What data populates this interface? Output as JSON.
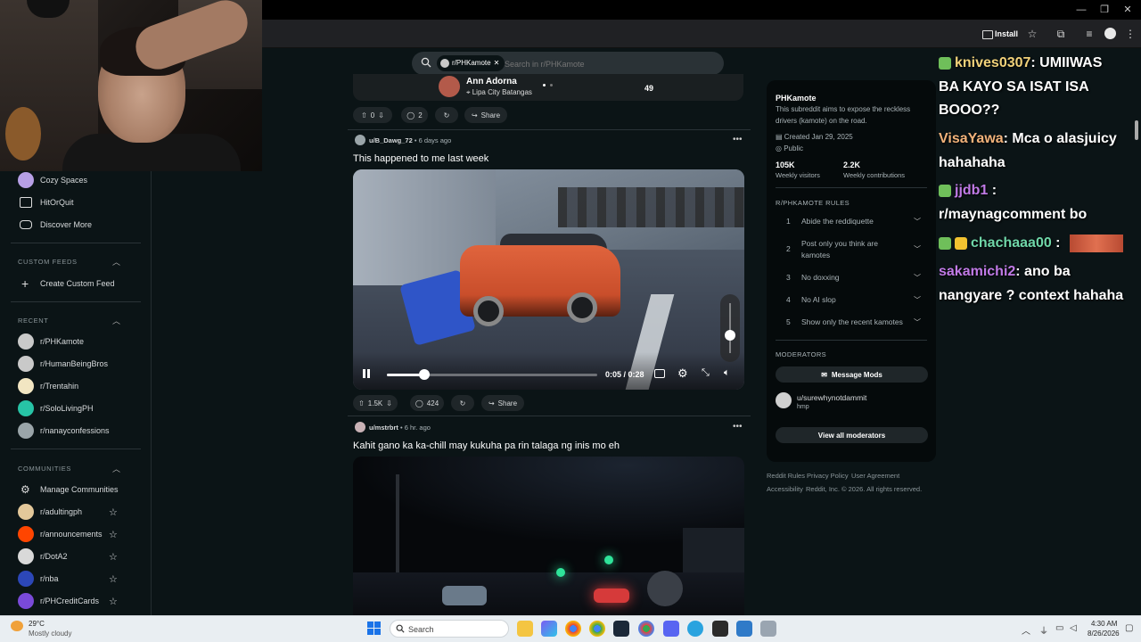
{
  "browser": {
    "install_label": "Install"
  },
  "search": {
    "chip_label": "r/PHKamote",
    "placeholder": "Search in r/PHKamote"
  },
  "sidebar": {
    "top_items": [
      {
        "label": "Cozy Spaces",
        "color": "#b7a0e6"
      },
      {
        "label": "HitOrQuit",
        "color": "#ffffff"
      },
      {
        "label": "Discover More",
        "color": "#ffffff"
      }
    ],
    "custom_feeds_heading": "CUSTOM FEEDS",
    "create_custom_feed": "Create Custom Feed",
    "recent_heading": "RECENT",
    "recent_items": [
      {
        "label": "r/PHKamote",
        "color": "#c9c9c9"
      },
      {
        "label": "r/HumanBeingBros",
        "color": "#c9c9c9"
      },
      {
        "label": "r/Trentahin",
        "color": "#f2e6c2"
      },
      {
        "label": "r/SoloLivingPH",
        "color": "#27c4a6"
      },
      {
        "label": "r/nanayconfessions",
        "color": "#9aa5a9"
      }
    ],
    "communities_heading": "COMMUNITIES",
    "manage_communities": "Manage Communities",
    "communities": [
      {
        "label": "r/adultingph",
        "color": "#e3c89a"
      },
      {
        "label": "r/announcements",
        "color": "#ff4500"
      },
      {
        "label": "r/DotA2",
        "color": "#d9d9d9"
      },
      {
        "label": "r/nba",
        "color": "#2c47b8"
      },
      {
        "label": "r/PHCreditCards",
        "color": "#7a4ad9"
      }
    ]
  },
  "feed": {
    "post0": {
      "author_name": "Ann Adorna",
      "location": "Lipa City Batangas",
      "side_number": "49",
      "votes": "0",
      "comments": "2",
      "share": "Share"
    },
    "post1": {
      "author": "u/B_Dawg_72",
      "age": "• 6 days ago",
      "title": "This happened to me last week",
      "votes": "1.5K",
      "comments": "424",
      "share": "Share",
      "time_current": "0:05",
      "time_total": "0:28",
      "time_display": "0:05 / 0:28",
      "progress": 0.18,
      "volume": 0.35
    },
    "post2": {
      "author": "u/mstrbrt",
      "age": "• 6 hr. ago",
      "title": "Kahit gano ka ka-chill may kukuha pa rin talaga ng inis mo eh"
    }
  },
  "community": {
    "name": "PHKamote",
    "description_line1": "This subreddit aims to expose the reckless",
    "description_line2": "drivers (kamote) on the road.",
    "created": "Created Jan 29, 2025",
    "visibility": "Public",
    "visitors_value": "105K",
    "visitors_label": "Weekly visitors",
    "contrib_value": "2.2K",
    "contrib_label": "Weekly contributions",
    "rules_heading": "R/PHKAMOTE RULES",
    "rules": [
      {
        "num": "1",
        "line1": "Abide the reddiquette",
        "line2": ""
      },
      {
        "num": "2",
        "line1": "Post only you think are",
        "line2": "kamotes"
      },
      {
        "num": "3",
        "line1": "No doxxing",
        "line2": ""
      },
      {
        "num": "4",
        "line1": "No AI slop",
        "line2": ""
      },
      {
        "num": "5",
        "line1": "Show only the recent kamotes",
        "line2": ""
      }
    ],
    "moderators_heading": "MODERATORS",
    "message_mods": "Message Mods",
    "mod_name": "u/surewhynotdammit",
    "mod_flair": "hmp",
    "view_all_mods": "View all moderators"
  },
  "footer": {
    "links": [
      "Reddit Rules",
      "Privacy Policy",
      "User Agreement"
    ],
    "accessibility": "Accessibility",
    "copyright": "Reddit, Inc. © 2026. All rights reserved."
  },
  "chat": [
    {
      "user": "knives0307",
      "user_color": "#f2d27a",
      "message": ": UMIIWAS"
    },
    {
      "user": "",
      "user_color": "#ffffff",
      "message": "BA KAYO SA ISAT ISA"
    },
    {
      "user": "",
      "user_color": "#ffffff",
      "message": "BOOO??"
    },
    {
      "user": "VisaYawa",
      "user_color": "#f2b27a",
      "message": ": Mca o alasjuicy"
    },
    {
      "user": "",
      "user_color": "#ffffff",
      "message": "hahahaha"
    },
    {
      "user": "jjdb1",
      "user_color": "#c07ae6",
      "message": " :"
    },
    {
      "user": "",
      "user_color": "#ffffff",
      "message": "r/maynagcomment bo"
    },
    {
      "user": "chachaaa00",
      "user_color": "#6fd6a8",
      "message": " :"
    },
    {
      "user": "sakamichi2",
      "user_color": "#c07ae6",
      "message": ": ano ba"
    },
    {
      "user": "",
      "user_color": "#ffffff",
      "message": "nangyare ? context hahaha"
    }
  ],
  "taskbar": {
    "weather_temp": "29°C",
    "weather_desc": "Mostly cloudy",
    "search_label": "Search",
    "time": "4:30 AM",
    "date": "8/26/2026"
  }
}
